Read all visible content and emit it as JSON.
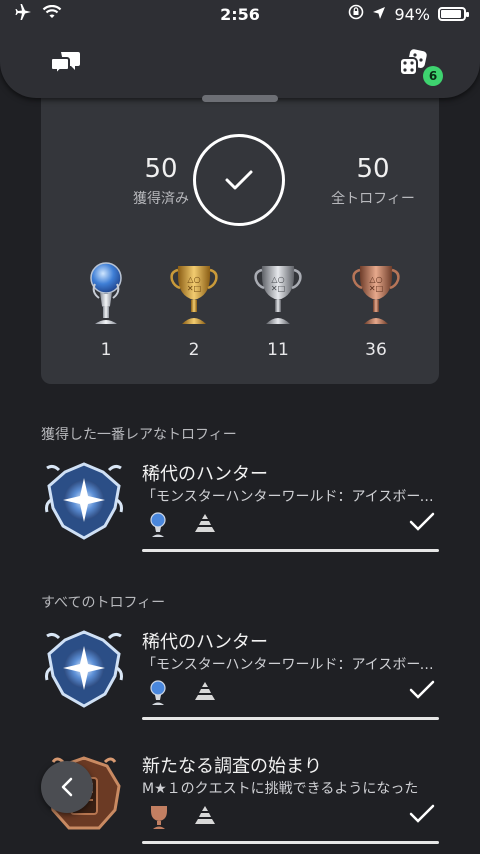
{
  "status_bar": {
    "time": "2:56",
    "battery": "94%",
    "icons": [
      "airplane-icon",
      "wifi-icon",
      "orientation-lock-icon",
      "location-icon",
      "battery-icon"
    ]
  },
  "header": {
    "left_icon": "chat-bubbles-icon",
    "right_icon": "game-dice-icon",
    "notification_count": "6"
  },
  "summary": {
    "earned_value": "50",
    "earned_label": "獲得済み",
    "total_value": "50",
    "total_label": "全トロフィー",
    "cups": [
      {
        "type": "platinum",
        "count": "1"
      },
      {
        "type": "gold",
        "count": "2"
      },
      {
        "type": "silver",
        "count": "11"
      },
      {
        "type": "bronze",
        "count": "36"
      }
    ]
  },
  "rarest": {
    "title": "獲得した一番レアなトロフィー",
    "trophy": {
      "name": "稀代のハンター",
      "description": "「モンスターハンターワールド：アイスボーン」の全トロフィーを獲得した"
    }
  },
  "all": {
    "title": "すべてのトロフィー",
    "trophies": [
      {
        "name": "稀代のハンター",
        "description": "「モンスターハンターワールド：アイスボーン」の全トロフィーを獲得した"
      },
      {
        "name": "新たなる調査の始まり",
        "description": "M★１のクエストに挑戦できるようになった"
      }
    ]
  },
  "colors": {
    "background": "#1f2024",
    "card": "#34363b",
    "badge": "#3ed36f"
  }
}
